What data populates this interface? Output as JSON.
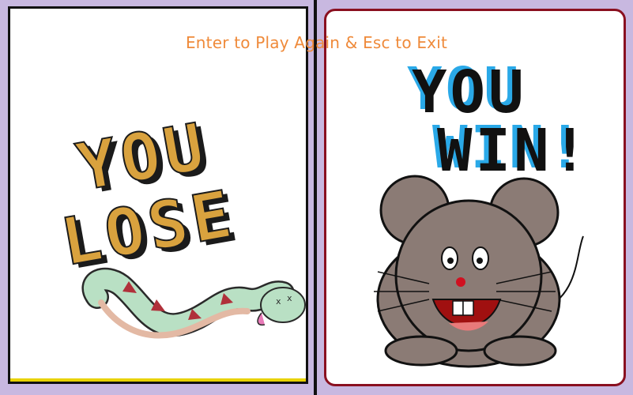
{
  "banner": "Enter to Play Again & Esc to Exit",
  "lose": {
    "line1": "YOU",
    "line2": "LOSE"
  },
  "win": {
    "line1": "YOU",
    "line2": "WIN!"
  },
  "colors": {
    "lose_text": "#d9a23e",
    "win_text": "#111111",
    "win_shadow": "#2aa9e8",
    "mouse": "#8b7b75",
    "snake": "#b9e0c4"
  },
  "icons": [
    "dead-snake-image",
    "mouse-image"
  ]
}
